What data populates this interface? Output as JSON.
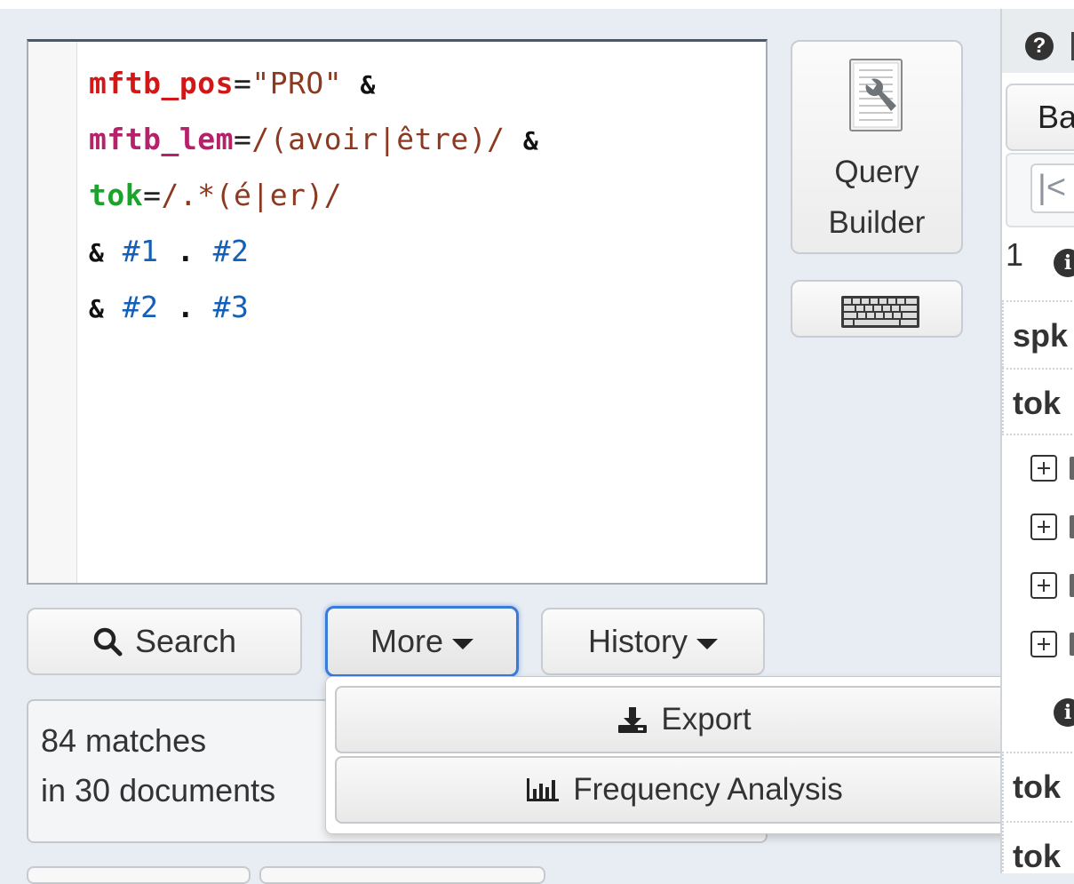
{
  "editor": {
    "lines": [
      {
        "k": "mftb_pos",
        "eq": "=",
        "v": "\"PRO\"",
        "amp": "&"
      },
      {
        "k": "mftb_lem",
        "eq": "=",
        "v": "/(avoir|être)/",
        "amp": "&"
      },
      {
        "k": "tok",
        "eq": "=",
        "v": "/.*(é|er)/"
      },
      {
        "amp": "&",
        "a": "#1",
        "dot": ".",
        "b": "#2"
      },
      {
        "amp": "&",
        "a": "#2",
        "dot": ".",
        "b": "#3"
      }
    ]
  },
  "side": {
    "query_builder_line1": "Query",
    "query_builder_line2": "Builder",
    "query_builder_icon": "wrench-document-icon",
    "keyboard_icon": "keyboard-icon"
  },
  "actions": {
    "search_label": "Search",
    "more_label": "More",
    "history_label": "History"
  },
  "menu": {
    "export_label": "Export",
    "frequency_label": "Frequency Analysis"
  },
  "status": {
    "matches": "84 matches",
    "documents": "in 30 documents"
  },
  "right_panel": {
    "help_icon": "?",
    "tab_partial": "Ba",
    "first_page_glyph": "|<",
    "result_number": "1",
    "info_glyph": "i",
    "row1": "spk",
    "row2": "tok",
    "row3": "tok",
    "row4": "tok"
  },
  "colors": {
    "key_red": "#d31717",
    "key_magenta": "#b5226a",
    "key_green": "#1ba32c",
    "string": "#8b3a21",
    "ref_blue": "#1460b8",
    "focus_blue": "#3a7ad9"
  }
}
